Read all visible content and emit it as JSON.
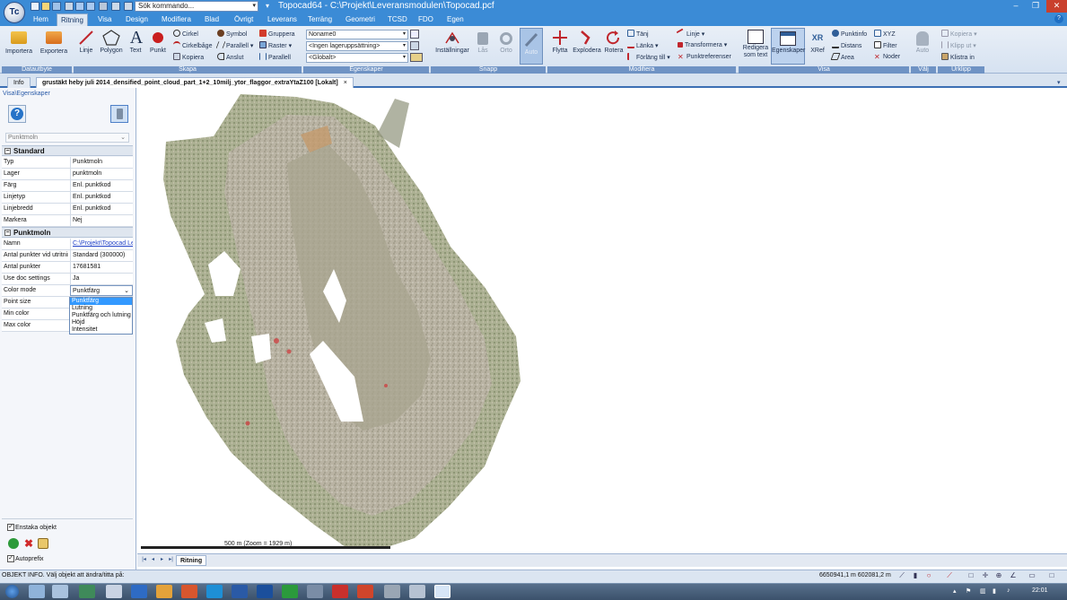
{
  "titlebar": {
    "command_search": "Sök kommando...",
    "title": "Topocad64 - C:\\Projekt\\Leveransmodulen\\Topocad.pcf",
    "controls": {
      "minimize": "–",
      "restore": "❐",
      "close": "✕"
    }
  },
  "menu": {
    "tabs": [
      "Hem",
      "Ritning",
      "Visa",
      "Design",
      "Modifiera",
      "Blad",
      "Övrigt",
      "Leverans",
      "Terräng",
      "Geometri",
      "TCSD",
      "FDO",
      "Egen"
    ],
    "active": "Ritning",
    "help": "?"
  },
  "ribbon": {
    "groups": [
      "Datautbyte",
      "Skapa",
      "Egenskaper",
      "Snapp",
      "Modifiera",
      "Visa",
      "Välj",
      "Urklipp"
    ],
    "datautbyte": {
      "import": "Importera",
      "export": "Exportera"
    },
    "skapa": {
      "big": [
        "Linje",
        "Polygon",
        "Text",
        "Punkt"
      ],
      "col1": [
        "Cirkel",
        "Cirkelbåge",
        "Kopiera"
      ],
      "col2": [
        "Symbol",
        "Parallell",
        "Anslut"
      ],
      "col3": [
        "Gruppera",
        "Raster",
        "Parallell"
      ]
    },
    "egenskaper": {
      "name": "Noname0",
      "layer": "<Ingen lageruppsättning>",
      "global": "<Globalt>"
    },
    "snapp": [
      "Inställningar",
      "Lås",
      "Orto",
      "Auto"
    ],
    "modifiera": {
      "big": [
        "Flytta",
        "Explodera",
        "Rotera"
      ],
      "col1": [
        "Tänj",
        "Länka",
        "Förläng till"
      ],
      "col2": [
        "Linje",
        "Transformera",
        "Punktreferenser"
      ]
    },
    "visa": {
      "big1": "Redigera som text",
      "big2": "Egenskaper",
      "big3": "XRef",
      "col1": [
        "Punktinfo",
        "Distans",
        "Area"
      ],
      "col2": [
        "XYZ",
        "Filter",
        "Noder"
      ]
    },
    "valj": "Auto",
    "urklipp": [
      "Kopiera",
      "Klipp ut",
      "Klistra in"
    ]
  },
  "doctabs": {
    "info": "Info",
    "doc": "grustäkt heby juli 2014_densified_point_cloud_part_1+2_10milj_ytor_flaggor_extraYtaZ100 [Lokalt]",
    "close": "×"
  },
  "leftpanel": {
    "breadcrumb": "Visa\\Egenskaper",
    "object_type": "Punktmoln",
    "standard": {
      "title": "Standard",
      "rows": [
        {
          "k": "Typ",
          "v": "Punktmoln"
        },
        {
          "k": "Lager",
          "v": "punktmoln"
        },
        {
          "k": "Färg",
          "v": "Enl. punktkod"
        },
        {
          "k": "Linjetyp",
          "v": "Enl. punktkod"
        },
        {
          "k": "Linjebredd",
          "v": "Enl. punktkod"
        },
        {
          "k": "Markera",
          "v": "Nej"
        }
      ]
    },
    "punktmoln": {
      "title": "Punktmoln",
      "rows": [
        {
          "k": "Namn",
          "v": "C:\\Projekt\\Topocad Lev"
        },
        {
          "k": "Antal punkter vid utritning",
          "v": "Standard (300000)"
        },
        {
          "k": "Antal punkter",
          "v": "17681581"
        },
        {
          "k": "Use doc settings",
          "v": "Ja"
        },
        {
          "k": "Color mode",
          "v": "Punktfärg"
        },
        {
          "k": "Point size",
          "v": ""
        },
        {
          "k": "Min color",
          "v": ""
        },
        {
          "k": "Max color",
          "v": ""
        }
      ]
    },
    "color_mode_options": [
      "Punktfärg",
      "Lutning",
      "Punktfärg och lutning",
      "Höjd",
      "Intensitet"
    ],
    "color_mode_selected": 0,
    "single_objects": "Enstaka objekt",
    "autoprefix": "Autoprefix"
  },
  "canvas": {
    "scale_label": "500 m (Zoom = 1929 m)",
    "sheet_tab": "Ritning"
  },
  "statusbar": {
    "left": "OBJEKT INFO. Välj objekt att ändra/titta på:",
    "coords": "6650941,1 m 602081,2 m"
  },
  "taskbar": {
    "clock": "22:01"
  }
}
